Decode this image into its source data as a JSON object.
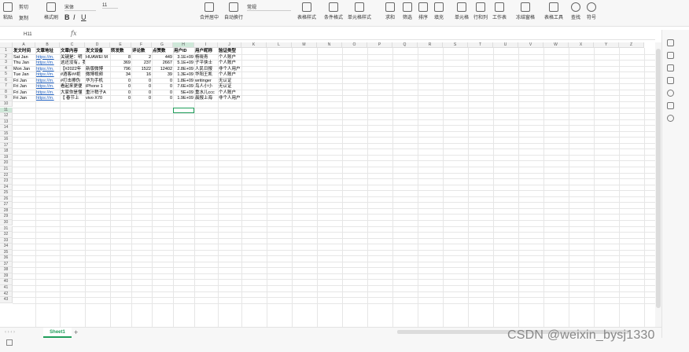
{
  "ribbon": {
    "groups": [
      {
        "label": "粘贴",
        "icon": "paste-icon"
      },
      {
        "label": "剪切",
        "icon": "cut-icon"
      },
      {
        "label": "复制",
        "icon": "copy-icon"
      },
      {
        "label": "格式刷",
        "icon": "format-painter-icon"
      }
    ],
    "font_name": "宋体",
    "font_size": "11",
    "bold": "B",
    "italic": "I",
    "underline": "U",
    "number_format": "常规",
    "buttons": [
      "合并居中",
      "自动换行",
      "表格样式",
      "条件格式",
      "单元格样式",
      "求和",
      "筛选",
      "排序",
      "填充",
      "单元格",
      "行和列",
      "工作表",
      "冻结窗格",
      "表格工具",
      "查找",
      "符号"
    ]
  },
  "formula_bar": {
    "cell_ref": "H11",
    "fx": "fx",
    "value": ""
  },
  "columns": [
    "A",
    "B",
    "C",
    "D",
    "E",
    "F",
    "G",
    "H",
    "I",
    "J",
    "K",
    "L",
    "M",
    "N",
    "O",
    "P",
    "Q",
    "R",
    "S",
    "T",
    "U",
    "V",
    "W",
    "X",
    "Y",
    "Z"
  ],
  "header_row": [
    "发文时间",
    "文章地址",
    "文章内容",
    "发文设备",
    "转发数",
    "评论数",
    "点赞数",
    "用户ID",
    "用户昵称",
    "验证类型"
  ],
  "rows": [
    [
      "Sat Jan",
      "https://m.",
      "关键是：明",
      "HUAWEI M",
      "8",
      "2",
      "449",
      "3.1E+09",
      "杨晓青",
      "个人账户"
    ],
    [
      "Thu Jan",
      "https://m.",
      "这还没有，我开始改过",
      "",
      "369",
      "237",
      "2667",
      "5.1E+09",
      "子平侠士",
      "个人账户"
    ],
    [
      "Mon Jan",
      "https://m.",
      "【#2022年",
      "新版微博",
      "796",
      "1522",
      "12402",
      "2.8E+09",
      "人民日报",
      "非个人用户"
    ],
    [
      "Tue Jan",
      "https://m.",
      "#酒客##拒",
      "微博视频",
      "34",
      "16",
      "39",
      "1.3E+09",
      "华阳王凯",
      "个人账户"
    ],
    [
      "Fri Jan",
      "https://m.",
      "#打击擦伪",
      "华为手机",
      "0",
      "0",
      "0",
      "1.8E+09",
      "writinger",
      "无认证"
    ],
    [
      "Fri Jan",
      "https://m.",
      "看起来更便",
      "iPhone 1",
      "0",
      "0",
      "0",
      "7.6E+09",
      "鸟人小小",
      "无认证"
    ],
    [
      "Fri Jan",
      "https://m.",
      "大家你是懂",
      "重汁稍子A",
      "0",
      "0",
      "0",
      "5E+09",
      "重水儿ccc",
      "个人账户"
    ],
    [
      "Fri Jan",
      "https://m.",
      "【 春节上",
      "vivo X70",
      "0",
      "0",
      "0",
      "1.9E+09",
      "晨报上海",
      "非个人用户"
    ]
  ],
  "row_numbers": [
    "1",
    "2",
    "3",
    "4",
    "5",
    "6",
    "7",
    "8",
    "9",
    "10",
    "11",
    "12",
    "13",
    "14",
    "15",
    "16",
    "17",
    "18",
    "19",
    "20",
    "21",
    "22",
    "23",
    "24",
    "25",
    "26",
    "27",
    "28",
    "29",
    "30",
    "31",
    "32",
    "33",
    "34",
    "35",
    "36",
    "37",
    "38",
    "39",
    "40",
    "41",
    "42",
    "43"
  ],
  "sheet_tab": "Sheet1",
  "add_sheet": "+",
  "watermark": "CSDN @weixin_bysj1330"
}
